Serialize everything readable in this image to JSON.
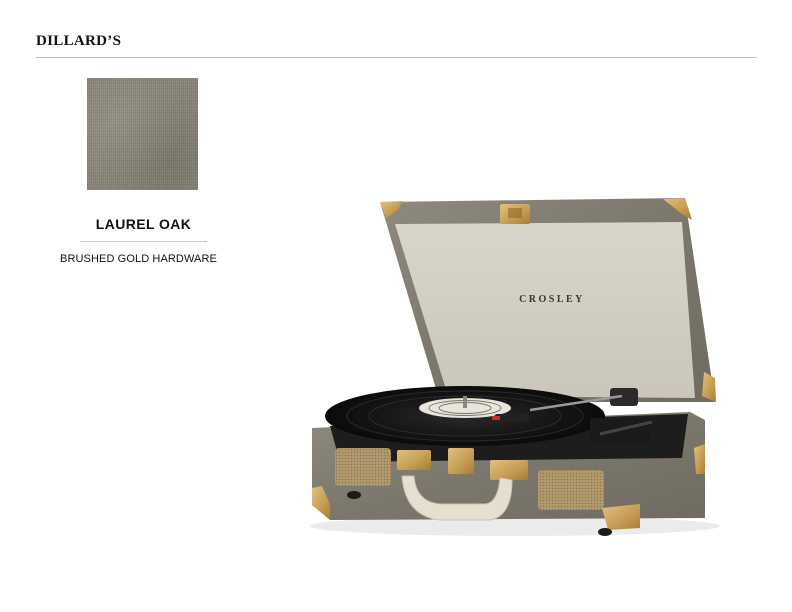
{
  "header": {
    "brand": "DILLARD’S"
  },
  "swatch": {
    "color": "#8a8679"
  },
  "color_option": {
    "name": "LAUREL OAK",
    "hardware": "BRUSHED GOLD HARDWARE"
  },
  "product": {
    "lid_logo": "CROSLEY",
    "case_color": "#7f7b70",
    "hardware_color": "#c9a25a"
  }
}
